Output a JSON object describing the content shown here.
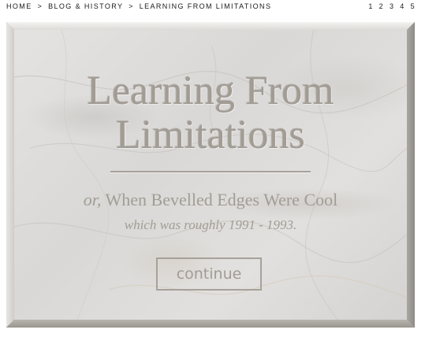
{
  "breadcrumb": {
    "items": [
      "HOME",
      "BLOG & HISTORY",
      "LEARNING FROM LIMITATIONS"
    ],
    "separator": ">"
  },
  "pager": {
    "pages": [
      "1",
      "2",
      "3",
      "4",
      "5"
    ]
  },
  "panel": {
    "title_line1": "Learning From",
    "title_line2": "Limitations",
    "subtitle_prefix": "or,",
    "subtitle": "When Bevelled Edges Were Cool",
    "tagline": "which was roughly 1991 - 1993.",
    "continue_label": "continue"
  },
  "colors": {
    "text_embossed": "#a29c94",
    "marble_base": "#dedcda",
    "bevel_dark": "#9d9994"
  }
}
